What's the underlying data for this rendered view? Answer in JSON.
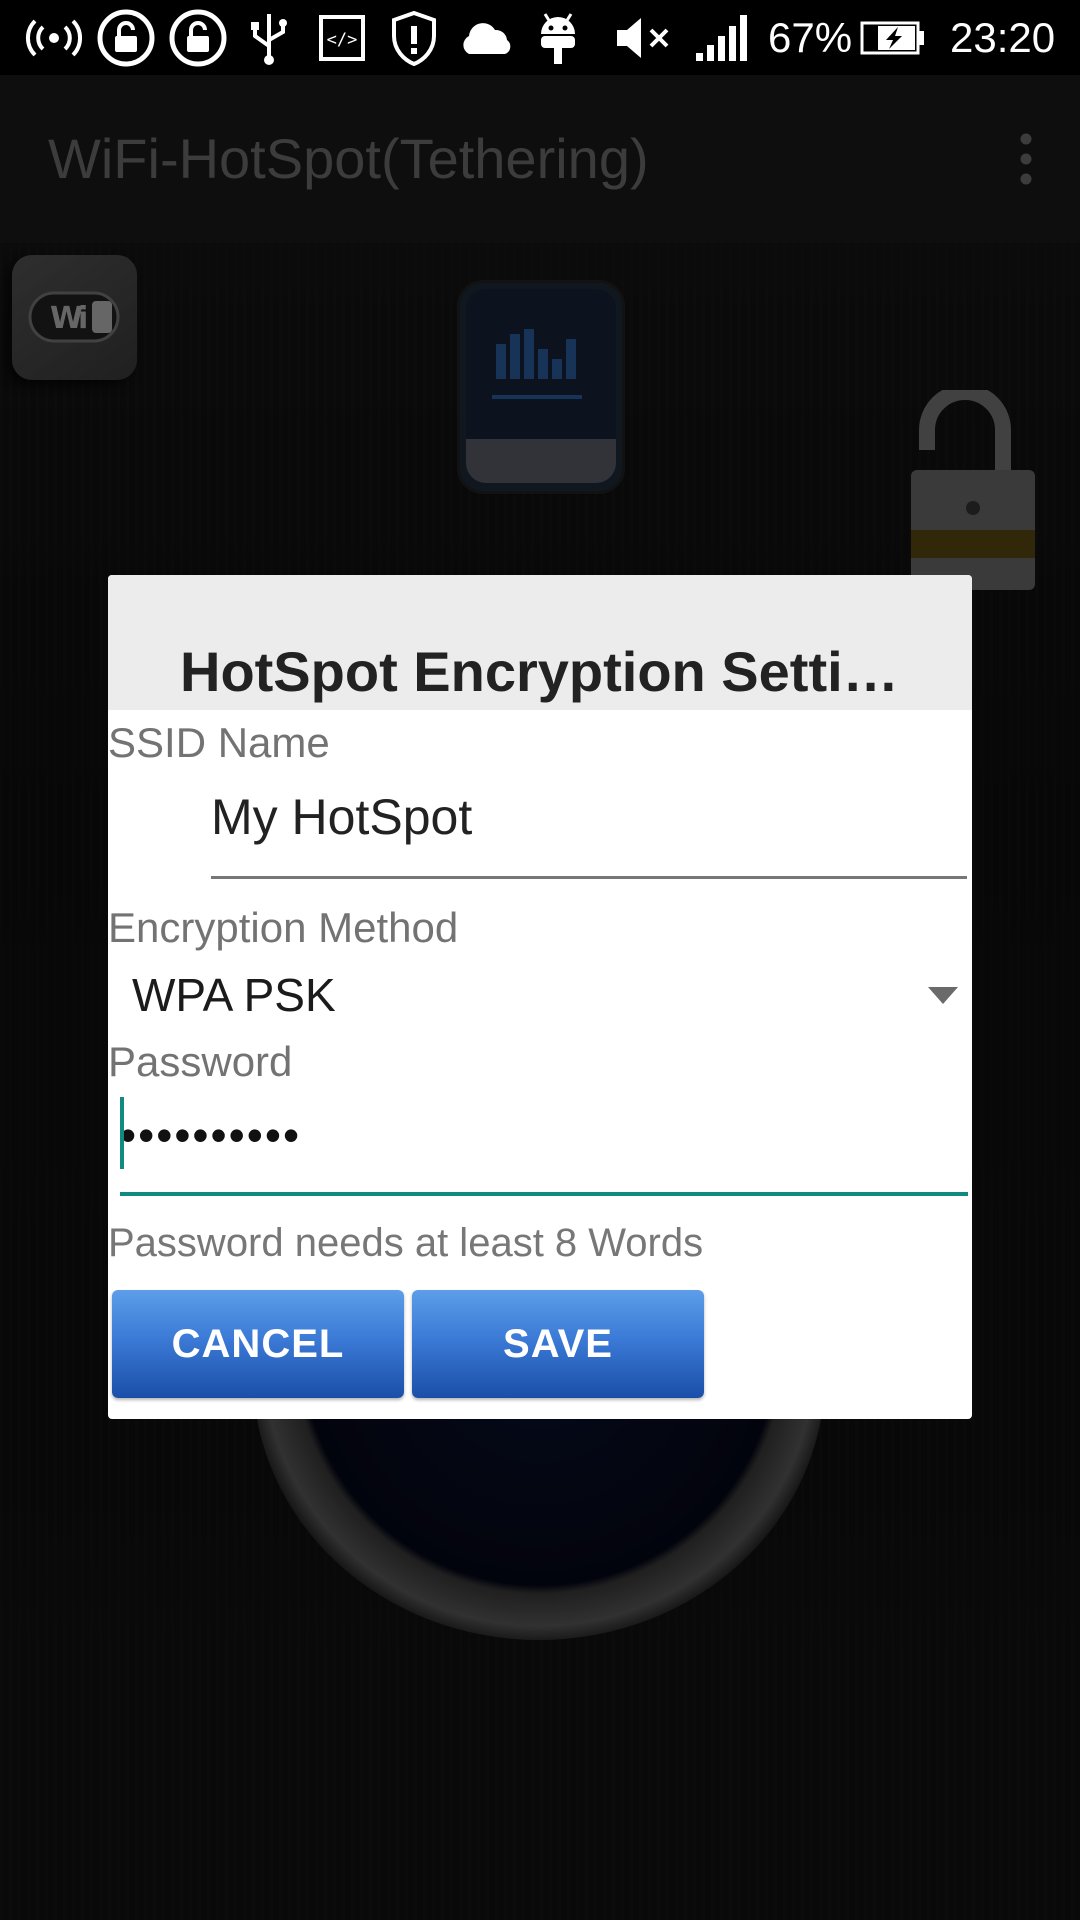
{
  "status_bar": {
    "battery_percent": "67%",
    "time": "23:20",
    "icons": [
      "wifi-tethering-icon",
      "lock-icon",
      "lock-icon",
      "usb-icon",
      "code-icon",
      "shield-icon",
      "cloud-icon",
      "android-icon",
      "mute-icon",
      "signal-icon",
      "battery-charging-icon"
    ]
  },
  "app": {
    "title": "WiFi-HotSpot(Tethering)",
    "menu_icon": "overflow-menu-icon"
  },
  "dialog": {
    "title": "HotSpot Encryption Setti…",
    "ssid_label": "SSID Name",
    "ssid_value": "My HotSpot",
    "encryption_label": "Encryption Method",
    "encryption_value": "WPA PSK",
    "password_label": "Password",
    "password_value": "••••••••••",
    "hint": "Password needs at least 8 Words",
    "cancel_label": "CANCEL",
    "save_label": "SAVE"
  },
  "colors": {
    "accent": "#128a7f",
    "button": "#3b7ad6"
  }
}
